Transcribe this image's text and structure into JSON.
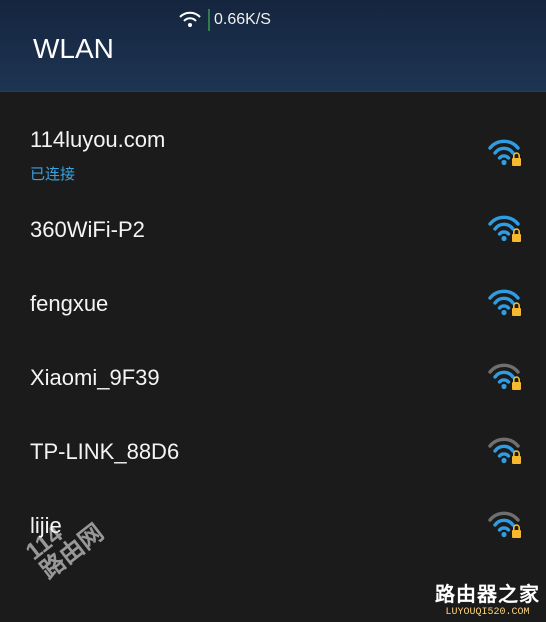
{
  "status": {
    "speed": "0.66K/S"
  },
  "header": {
    "title": "WLAN"
  },
  "networks": [
    {
      "ssid": "114luyou.com",
      "status": "已连接",
      "signal": "full"
    },
    {
      "ssid": "360WiFi-P2",
      "signal": "full"
    },
    {
      "ssid": "fengxue",
      "signal": "full"
    },
    {
      "ssid": "Xiaomi_9F39",
      "signal": "partial"
    },
    {
      "ssid": "TP-LINK_88D6",
      "signal": "partial"
    },
    {
      "ssid": "lijie",
      "signal": "partial"
    }
  ],
  "colors": {
    "signal_active": "#2f9de3",
    "signal_inactive": "#6f6f6f",
    "lock": "#f5b82e",
    "connected": "#3aa2df"
  },
  "icons": {
    "signal": "wifi-lock-icon",
    "status_wifi": "wifi-icon"
  },
  "watermark": {
    "text_a": "114",
    "text_b": "路由网"
  },
  "site_mark": {
    "name": "路由器之家",
    "url": "LUYOUQI520.COM"
  }
}
